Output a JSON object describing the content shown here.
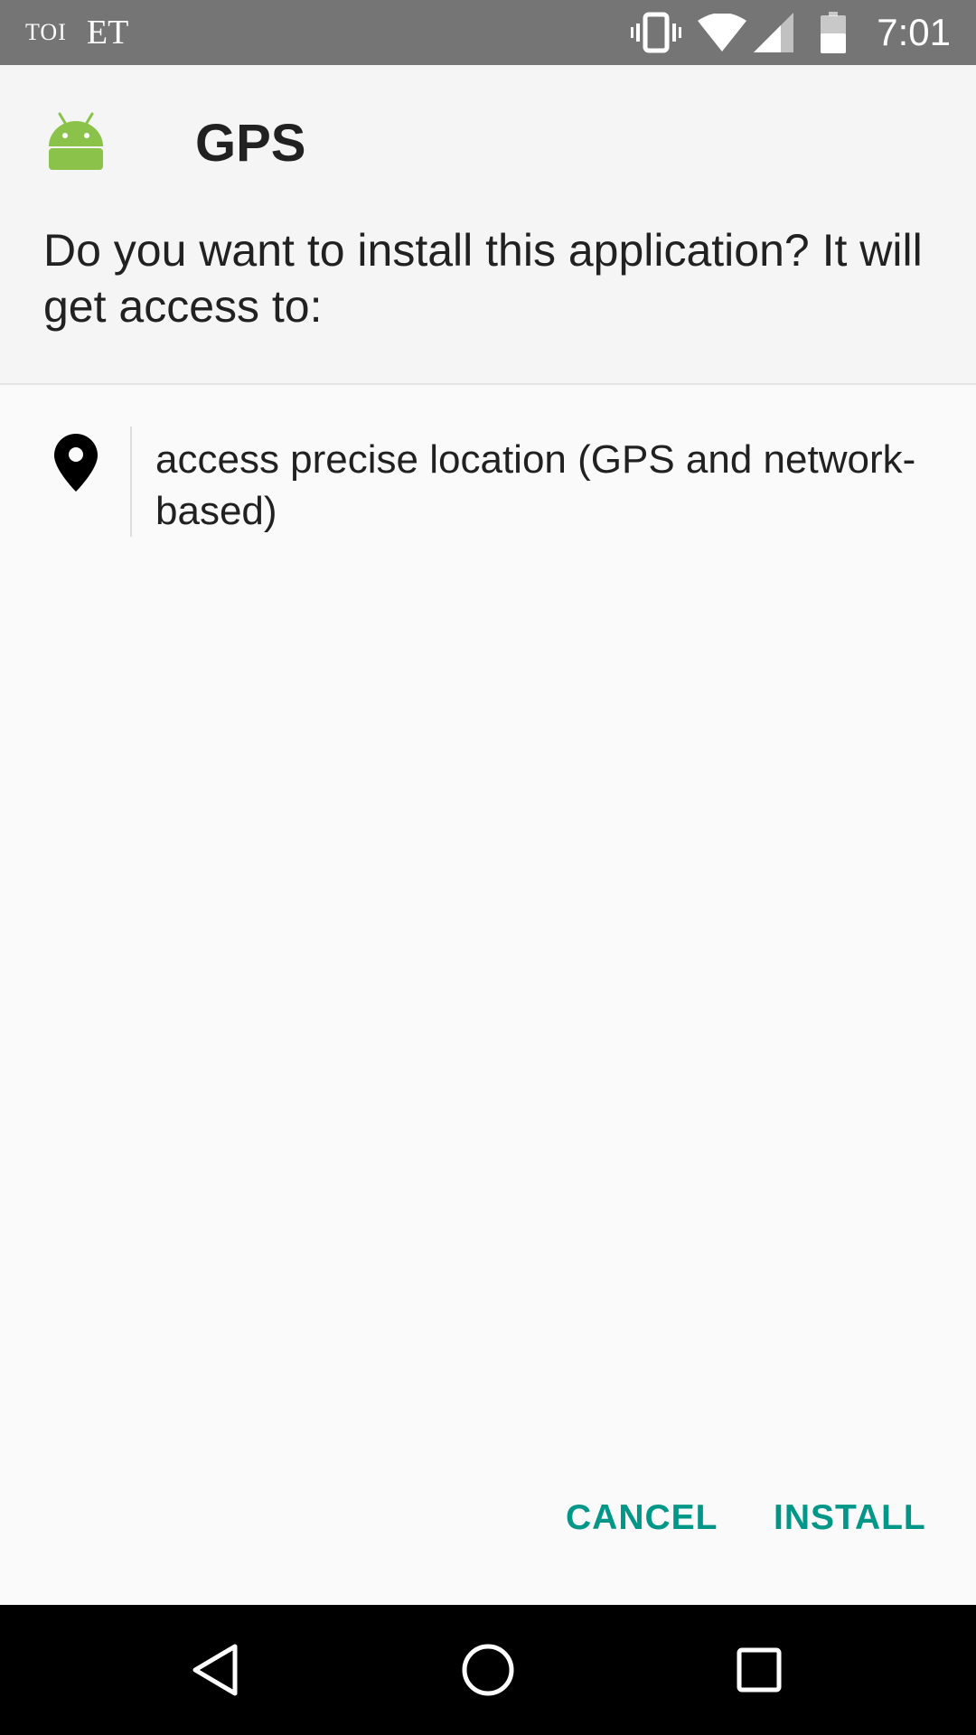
{
  "status_bar": {
    "notifications": [
      "TOI",
      "ET"
    ],
    "icons": [
      "vibrate-icon",
      "wifi-icon",
      "cell-signal-icon",
      "battery-icon"
    ],
    "time": "7:01"
  },
  "app": {
    "name": "GPS",
    "icon": "android-robot-icon"
  },
  "dialog": {
    "prompt": "Do you want to install this application? It will get access to:",
    "permissions": [
      {
        "icon": "location-pin-icon",
        "label": "access precise location (GPS and network-based)"
      }
    ],
    "cancel_label": "CANCEL",
    "install_label": "INSTALL"
  },
  "nav_bar": {
    "icons": [
      "back-icon",
      "home-icon",
      "recents-icon"
    ]
  },
  "colors": {
    "accent": "#009688",
    "status_bar": "#757575",
    "android_green": "#8bc34a"
  }
}
